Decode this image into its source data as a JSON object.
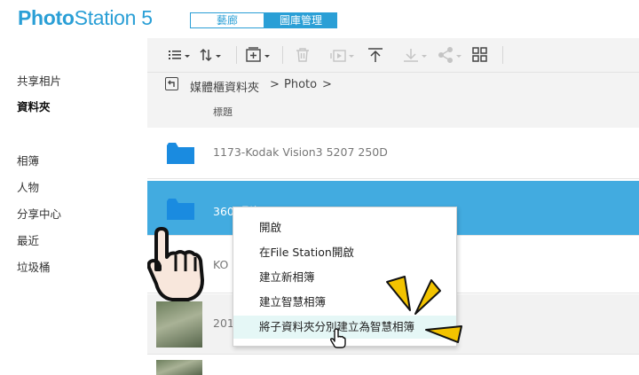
{
  "app": {
    "logo_bold": "Photo",
    "logo_rest": "Station 5",
    "mode_gallery": "藝廊",
    "mode_manage": "圖庫管理"
  },
  "sidebar": {
    "items": [
      {
        "label": "共享相片",
        "active": false
      },
      {
        "label": "資料夾",
        "active": true
      },
      {
        "label": "相簿",
        "active": false
      },
      {
        "label": "人物",
        "active": false
      },
      {
        "label": "分享中心",
        "active": false
      },
      {
        "label": "最近",
        "active": false
      },
      {
        "label": "垃圾桶",
        "active": false
      }
    ]
  },
  "toolbar": {
    "icons": [
      "list-view-icon",
      "sort-icon",
      "add-icon",
      "trash-icon",
      "slideshow-icon",
      "upload-icon",
      "download-icon",
      "share-icon",
      "grid-icon"
    ]
  },
  "breadcrumb": {
    "root": "媒體櫃資料夾",
    "sep1": ">",
    "folder": "Photo",
    "sep2": ">"
  },
  "table": {
    "column_title": "標題",
    "rows": [
      {
        "name": "1173-Kodak Vision3 5207 250D",
        "type": "folder",
        "selected": false
      },
      {
        "name": "360 照片",
        "type": "folder",
        "selected": true
      },
      {
        "name": "KO",
        "type": "folder",
        "selected": false
      },
      {
        "name": "201",
        "type": "photo",
        "selected": false
      },
      {
        "name": "",
        "type": "photo",
        "selected": false
      }
    ]
  },
  "context_menu": {
    "items": [
      {
        "label": "開啟",
        "highlighted": false
      },
      {
        "label": "在File Station開啟",
        "highlighted": false
      },
      {
        "label": "建立新相簿",
        "highlighted": false
      },
      {
        "label": "建立智慧相簿",
        "highlighted": false
      },
      {
        "label": "將子資料夾分別建立為智慧相簿",
        "highlighted": true
      }
    ]
  },
  "colors": {
    "accent": "#2a9fd6",
    "selected_row": "#42abe0",
    "folder": "#1a8be0",
    "menu_highlight": "#e5f7f6",
    "sparkle": "#f2c300"
  }
}
